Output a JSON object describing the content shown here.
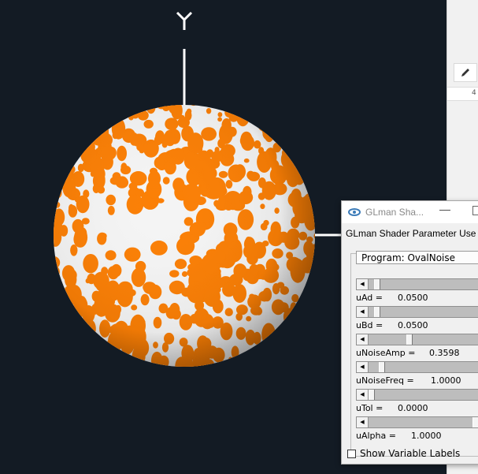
{
  "colors": {
    "viewport_bg": "#131b24",
    "noise_orange": "#fb7f05",
    "sphere_white": "#f4f4f4"
  },
  "scene": {
    "axis_label_y": "Y"
  },
  "background_window": {
    "pen_icon": "pen-icon",
    "ruler_number": "4"
  },
  "panel": {
    "window_title": "GLman Sha...",
    "app_icon": "glman-app-icon",
    "minimize_glyph": "—",
    "heading": "GLman Shader Parameter Use",
    "program_label": "Program: OvalNoise",
    "parameters": [
      {
        "name": "uAd =",
        "value": "0.0500",
        "level": 0.05
      },
      {
        "name": "uBd =",
        "value": "0.0500",
        "level": 0.05
      },
      {
        "name": "uNoiseAmp =",
        "value": "0.3598",
        "level": 0.36
      },
      {
        "name": "uNoiseFreq =",
        "value": "1.0000",
        "level": 0.1
      },
      {
        "name": "uTol =",
        "value": "0.0000",
        "level": 0.0
      },
      {
        "name": "uAlpha =",
        "value": "1.0000",
        "level": 1.0
      }
    ],
    "show_labels_text": "Show Variable Labels",
    "show_labels_checked": false
  }
}
